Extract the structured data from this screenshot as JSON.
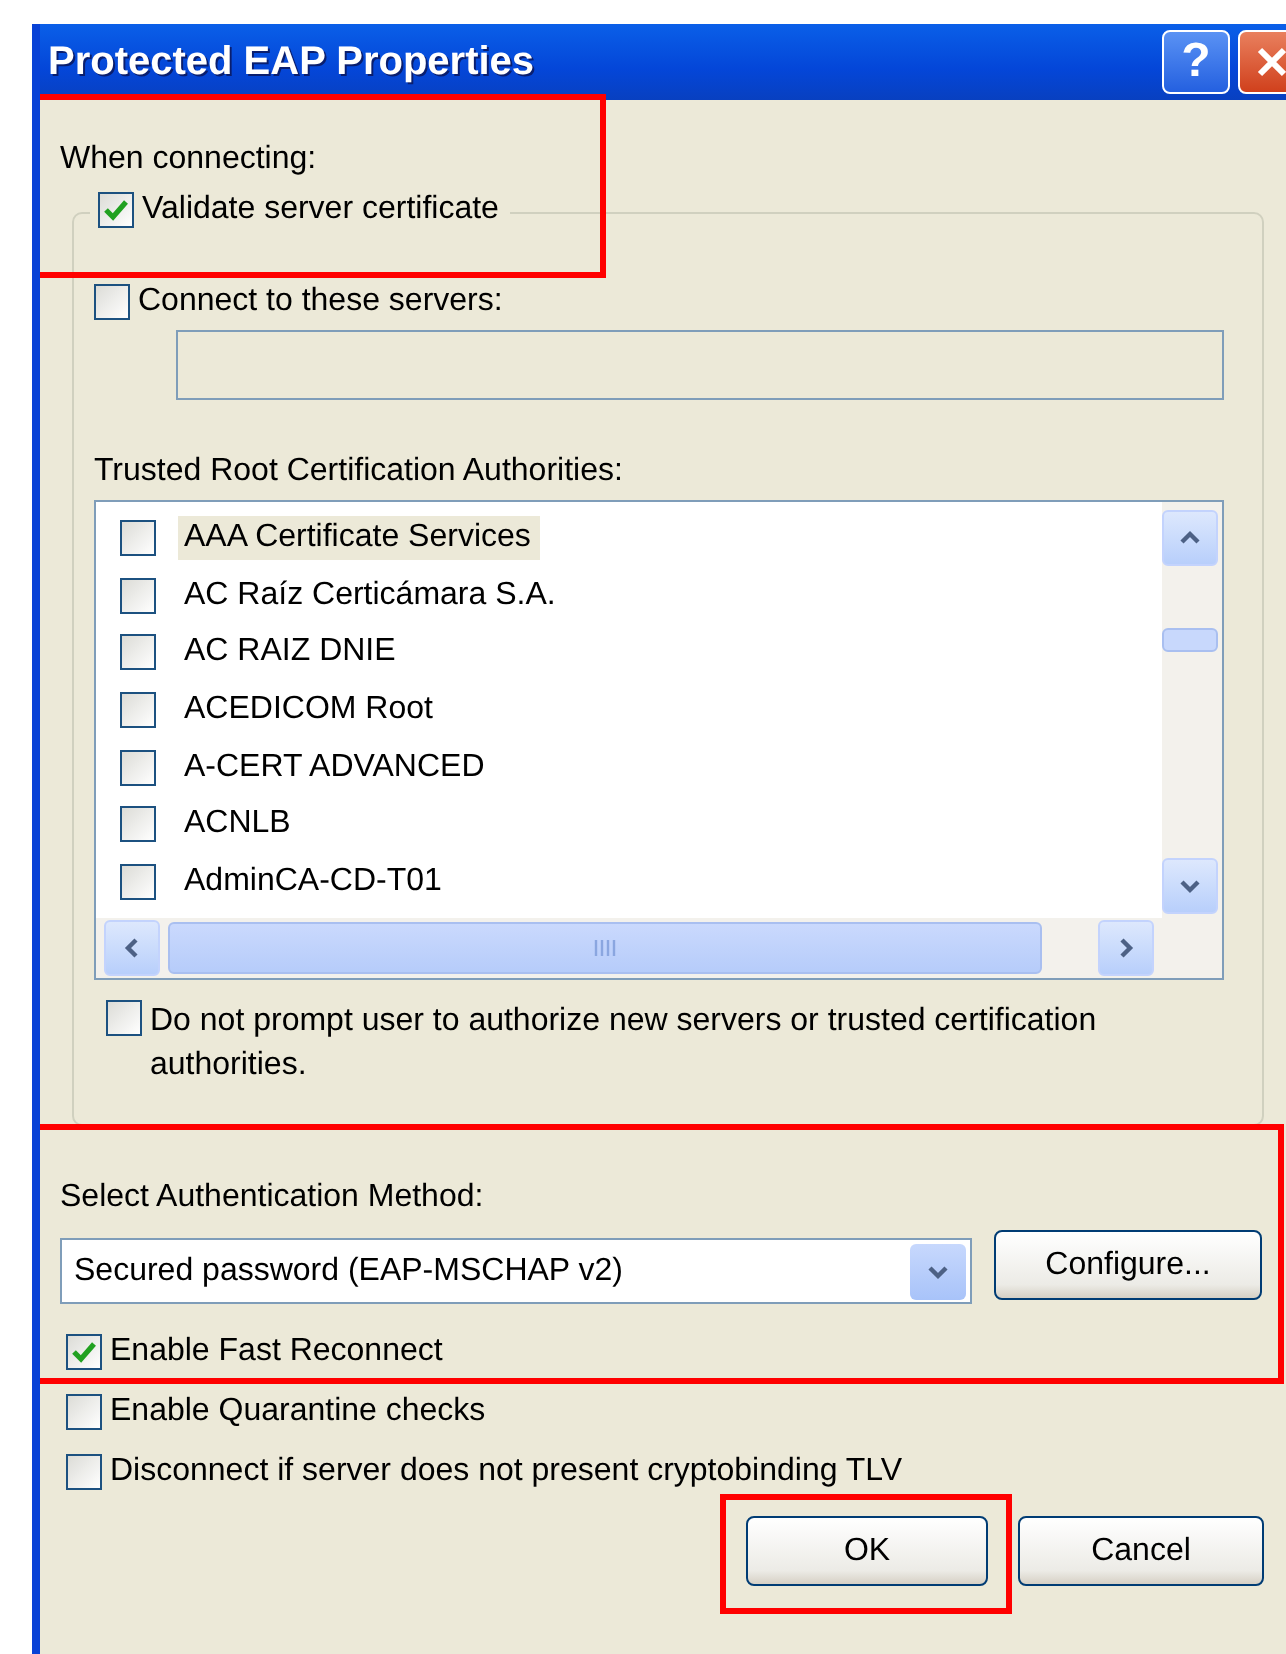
{
  "window": {
    "title": "Protected EAP Properties",
    "help": "?"
  },
  "when_connecting": {
    "label": "When connecting:",
    "highlighted": true,
    "validate": {
      "label": "Validate server certificate",
      "checked": true
    }
  },
  "connect_servers": {
    "label": "Connect to these servers:",
    "checked": false
  },
  "trusted_roots": {
    "label": "Trusted Root Certification Authorities:",
    "items": [
      {
        "name": "AAA Certificate Services",
        "checked": false,
        "selected": true
      },
      {
        "name": "AC Raíz Certicámara S.A.",
        "checked": false,
        "selected": false
      },
      {
        "name": "AC RAIZ DNIE",
        "checked": false,
        "selected": false
      },
      {
        "name": "ACEDICOM Root",
        "checked": false,
        "selected": false
      },
      {
        "name": "A-CERT ADVANCED",
        "checked": false,
        "selected": false
      },
      {
        "name": "ACNLB",
        "checked": false,
        "selected": false
      },
      {
        "name": "AdminCA-CD-T01",
        "checked": false,
        "selected": false
      }
    ]
  },
  "no_prompt": {
    "label": "Do not prompt user to authorize new servers or trusted certification authorities.",
    "checked": false
  },
  "auth": {
    "label": "Select Authentication Method:",
    "highlighted": true,
    "method": "Secured password (EAP-MSCHAP v2)",
    "configure": "Configure...",
    "fast_reconnect": {
      "label": "Enable Fast Reconnect",
      "checked": true
    }
  },
  "options": [
    {
      "label": "Enable Quarantine checks",
      "checked": false
    },
    {
      "label": "Disconnect if server does not present cryptobinding TLV",
      "checked": false
    }
  ],
  "buttons": [
    {
      "label": "OK",
      "highlighted": true
    },
    {
      "label": "Cancel",
      "highlighted": false
    }
  ]
}
